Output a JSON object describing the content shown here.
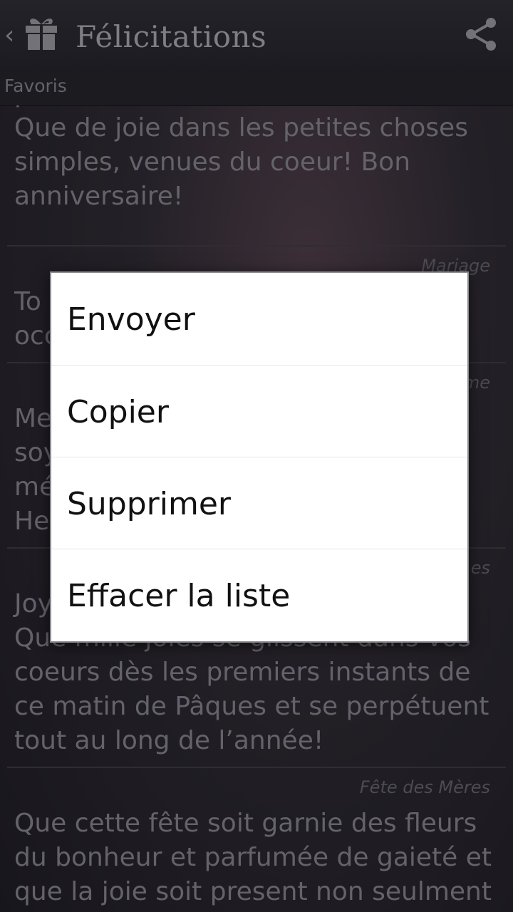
{
  "app_bar": {
    "title": "Félicitations",
    "up_icon": "chevron-left-icon",
    "app_icon": "gift-icon",
    "action_icon": "share-icon"
  },
  "section": {
    "label": "Favoris"
  },
  "cards": [
    {
      "category": "",
      "message": "pluie d'été sur les fleurs assorties.\nQue de joie dans les petites choses\nsimples, venues du coeur! Bon\nanniversaire!"
    },
    {
      "category": "Mariage",
      "message": "To\nocc"
    },
    {
      "category": "me",
      "message": "Me\nsoy\nmé\nHe"
    },
    {
      "category": "es",
      "message": "Joy\nQue mille joies se glissent dans vos\ncoeurs dès les premiers instants de\nce matin de Pâques et se perpétuent\ntout au long de l’année!"
    },
    {
      "category": "Fête des Mères",
      "message": "Que cette fête soit garnie des fleurs\ndu bonheur et parfumée de gaieté et\nque la joie soit present non seulment"
    }
  ],
  "dialog": {
    "items": [
      {
        "label": "Envoyer"
      },
      {
        "label": "Copier"
      },
      {
        "label": "Supprimer"
      },
      {
        "label": "Effacer la liste"
      }
    ]
  },
  "colors": {
    "accent_text": "#9a9aa0",
    "dialog_bg": "#ffffff"
  }
}
